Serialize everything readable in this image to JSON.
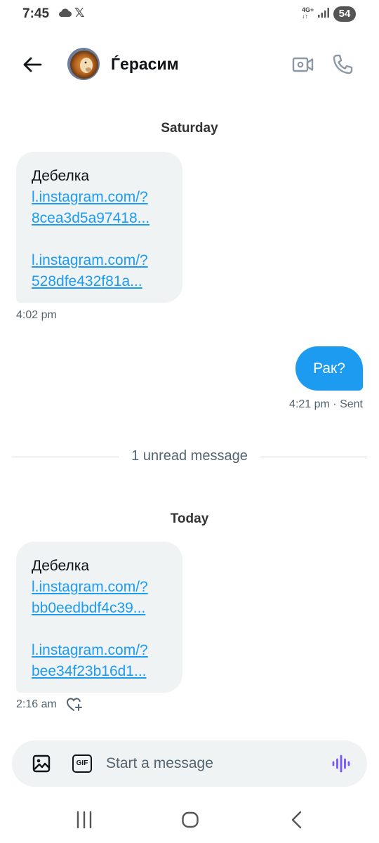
{
  "status_bar": {
    "time": "7:45",
    "x_logo": "𝕏",
    "network_label": "4G+",
    "battery": "54",
    "icons": [
      "cloud-icon",
      "x-logo",
      "signal-icon",
      "battery-icon"
    ]
  },
  "header": {
    "contact_name": "Ѓерасим",
    "icons": [
      "back-arrow-icon",
      "video-call-icon",
      "phone-icon"
    ]
  },
  "conversation": {
    "saturday": {
      "day_label": "Saturday",
      "incoming": {
        "text": "Дебелка",
        "link1": [
          "l.instagram.com/?",
          "8cea3d5a97418..."
        ],
        "link2": [
          "l.instagram.com/?",
          "528dfe432f81a..."
        ],
        "time": "4:02 pm"
      },
      "outgoing": {
        "text": "Рак?",
        "meta": "4:21 pm · Sent"
      }
    },
    "unread_divider": "1 unread message",
    "today": {
      "day_label": "Today",
      "incoming": {
        "text": "Дебелка",
        "link1": [
          "l.instagram.com/?",
          "bb0eedbdf4c39..."
        ],
        "link2": [
          "l.instagram.com/?",
          "bee34f23b16d1..."
        ],
        "time": "2:16 am"
      }
    }
  },
  "composer": {
    "placeholder": "Start a message",
    "gif_label": "GIF",
    "icons": [
      "image-icon",
      "gif-icon",
      "voice-icon"
    ]
  },
  "nav_bar": {
    "icons": [
      "recents-icon",
      "home-icon",
      "back-icon"
    ]
  },
  "colors": {
    "accent": "#1d9bf0",
    "bubble_in": "#eff3f4",
    "voice": "#7856ff",
    "text_secondary": "#536471"
  }
}
